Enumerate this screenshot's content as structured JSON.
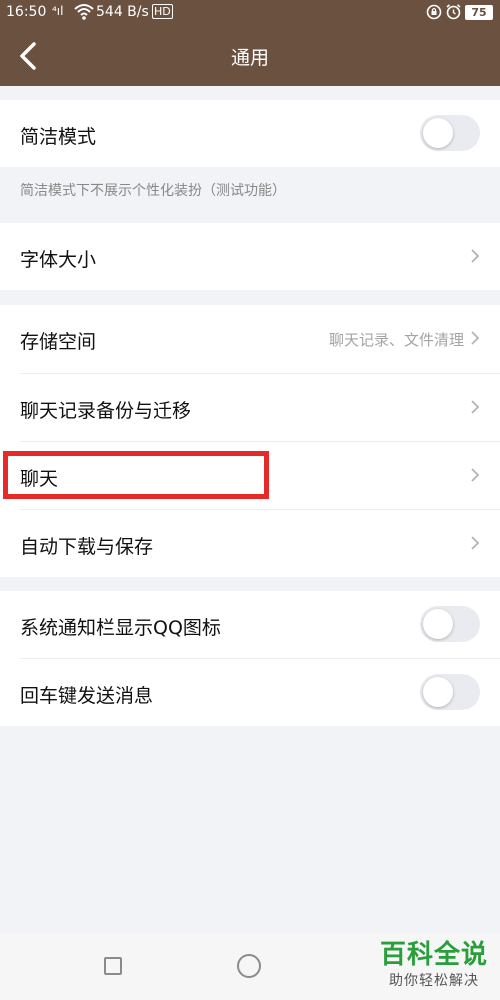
{
  "status_bar": {
    "time": "16:50",
    "signal": "⁴ıl",
    "net_speed": "544 B/s",
    "hd": "HD",
    "battery": "75"
  },
  "nav": {
    "title": "通用"
  },
  "settings": {
    "simple_mode": {
      "label": "简洁模式",
      "enabled": false
    },
    "simple_mode_hint": "简洁模式下不展示个性化装扮（测试功能）",
    "font_size": {
      "label": "字体大小"
    },
    "storage": {
      "label": "存储空间",
      "detail": "聊天记录、文件清理"
    },
    "backup": {
      "label": "聊天记录备份与迁移"
    },
    "chat": {
      "label": "聊天"
    },
    "auto_download": {
      "label": "自动下载与保存"
    },
    "notify_icon": {
      "label": "系统通知栏显示QQ图标",
      "enabled": false
    },
    "enter_send": {
      "label": "回车键发送消息",
      "enabled": false
    }
  },
  "watermark": {
    "main": "百科全说",
    "sub": "助你轻松解决"
  },
  "colors": {
    "header": "#6b5140",
    "highlight": "#e52a2a",
    "watermark": "#2a9e3b"
  }
}
